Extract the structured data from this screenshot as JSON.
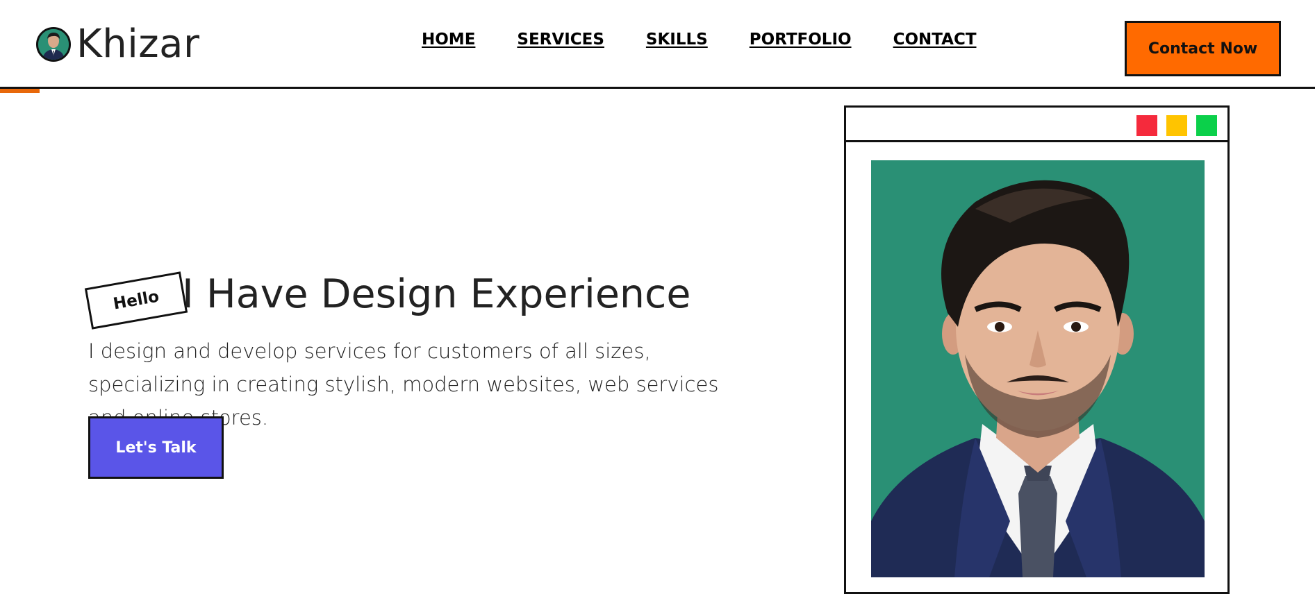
{
  "brand": {
    "name": "Khizar"
  },
  "nav": {
    "items": [
      {
        "label": "HOME"
      },
      {
        "label": "SERVICES"
      },
      {
        "label": "SKILLS"
      },
      {
        "label": "PORTFOLIO"
      },
      {
        "label": "CONTACT"
      }
    ]
  },
  "header": {
    "contact_button_label": "Contact Now",
    "scroll_progress_percent": 3
  },
  "hero": {
    "tag": "Hello",
    "title": "I Have Design Experience",
    "description": "I design and develop services for customers of all sizes, specializing in creating stylish, modern websites, web services and online stores.",
    "cta_label": "Let's Talk"
  },
  "colors": {
    "accent_orange": "#ff6a00",
    "cta_purple": "#5a55e8",
    "portrait_bg": "#2a9075",
    "dot_red": "#f52a3c",
    "dot_yellow": "#ffc400",
    "dot_green": "#0bd04a"
  },
  "icons": [
    "avatar-icon",
    "window-dot-icon"
  ]
}
